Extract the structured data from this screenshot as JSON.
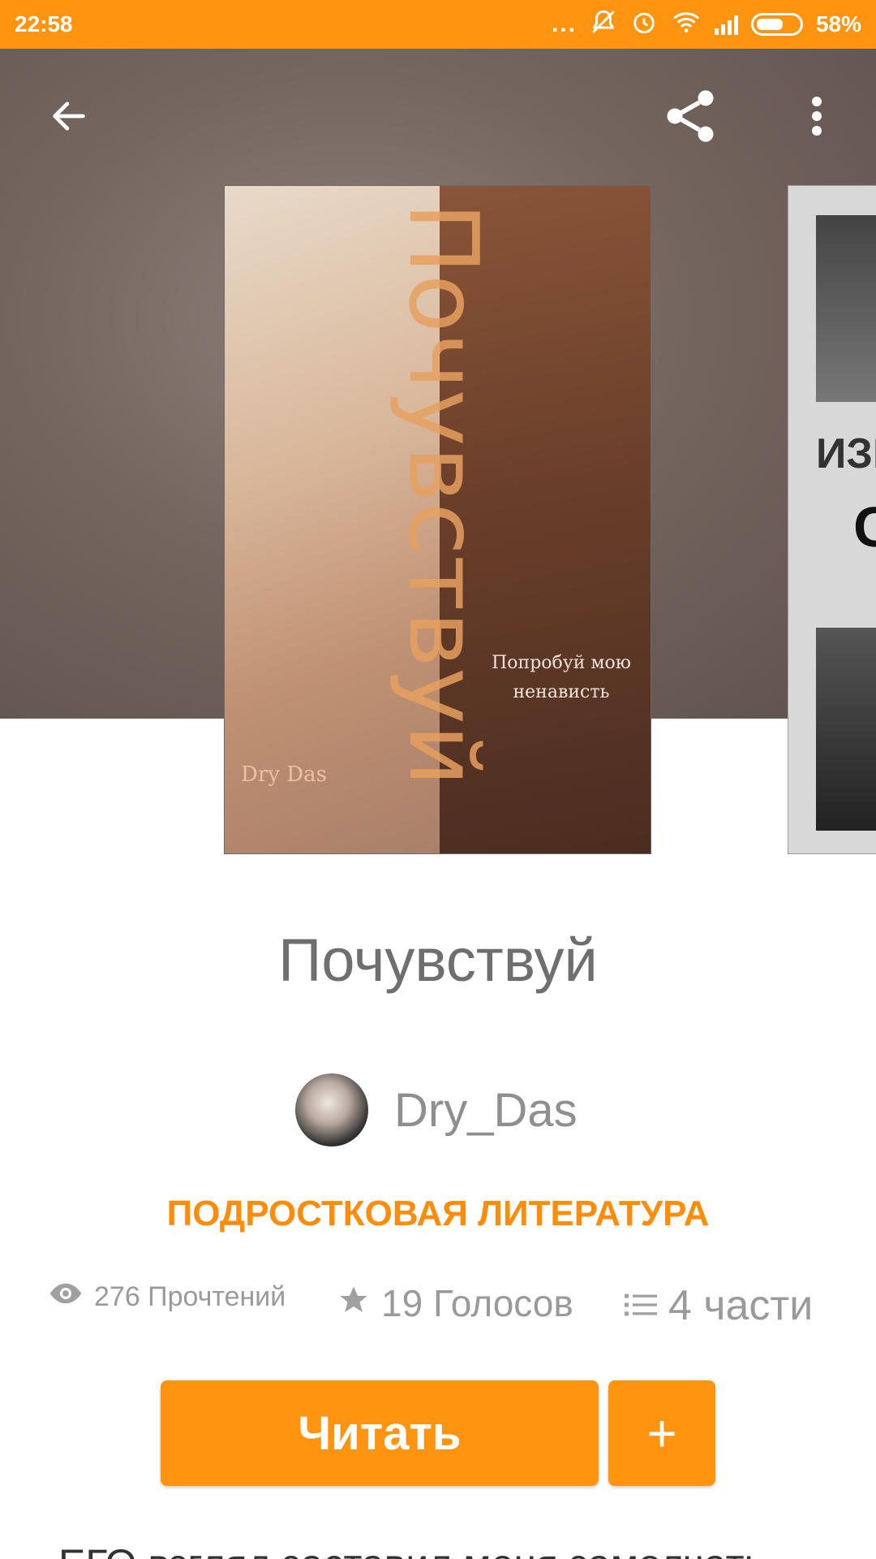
{
  "status_bar": {
    "time": "22:58",
    "dots": "...",
    "battery": "58%",
    "icons": [
      "mute-icon",
      "alarm-icon",
      "wifi-icon",
      "signal-icon",
      "battery-icon"
    ]
  },
  "toolbar": {
    "icons": [
      "back-arrow-icon",
      "share-icon",
      "more-vert-icon"
    ]
  },
  "cover": {
    "title": "Почувствуй",
    "tagline": "Попробуй мою ненависть",
    "author": "Dry Das"
  },
  "next_cover": {
    "text1": "ИЗЬ",
    "text2": "С"
  },
  "story": {
    "title": "Почувствуй",
    "author": "Dry_Das",
    "category": "ПОДРОСТКОВАЯ ЛИТЕРАТУРА",
    "reads": "276 Прочтений",
    "votes": "19 Голосов",
    "parts": "4 части"
  },
  "actions": {
    "read_label": "Читать",
    "add_label": "+"
  },
  "description_peek": "ЕГО взгляд заставил меня замолчать",
  "colors": {
    "accent": "#FF9411",
    "category": "#FF8C0A"
  }
}
